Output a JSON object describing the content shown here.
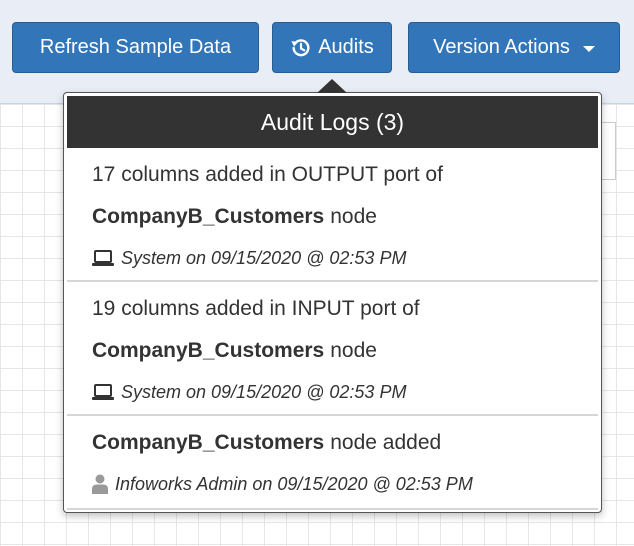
{
  "toolbar": {
    "refresh_label": "Refresh Sample Data",
    "audits_label": "Audits",
    "audits_icon": "history-icon",
    "version_label": "Version Actions",
    "button_color": "#3276b9"
  },
  "audit_popover": {
    "title": "Audit Logs (3)",
    "entries": [
      {
        "line1": "17 columns added in OUTPUT port of",
        "node": "CompanyB_Customers",
        "suffix": "node",
        "icon": "laptop-icon",
        "meta": "System on 09/15/2020 @ 02:53 PM"
      },
      {
        "line1": "19 columns added in INPUT port of",
        "node": "CompanyB_Customers",
        "suffix": "node",
        "icon": "laptop-icon",
        "meta": "System on 09/15/2020 @ 02:53 PM"
      },
      {
        "node": "CompanyB_Customers",
        "suffix": "node added",
        "icon": "user-icon",
        "meta": "Infoworks Admin on 09/15/2020 @ 02:53 PM"
      }
    ]
  }
}
